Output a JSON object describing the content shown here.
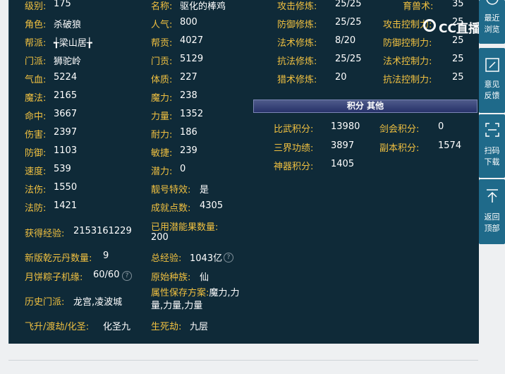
{
  "col1": {
    "level_label": "级别:",
    "level_value": "175",
    "role_label": "角色:",
    "role_value": "杀破狼",
    "gang_label": "帮派:",
    "gang_value": "╅梁山居╆",
    "sect_label": "门派:",
    "sect_value": "狮驼岭",
    "hp_label": "气血:",
    "hp_value": "5224",
    "mp_label": "魔法:",
    "mp_value": "2165",
    "hit_label": "命中:",
    "hit_value": "3667",
    "dmg_label": "伤害:",
    "dmg_value": "2397",
    "def_label": "防御:",
    "def_value": "1103",
    "spd_label": "速度:",
    "spd_value": "539",
    "mdmg_label": "法伤:",
    "mdmg_value": "1550",
    "mdef_label": "法防:",
    "mdef_value": "1421",
    "exp_label": "获得经验:",
    "exp_value": "2153161229",
    "qyd_label": "新版乾元丹数量:",
    "qyd_value": "9",
    "yb_label": "月饼粽子机缘:",
    "yb_value": "60/60",
    "hist_label": "历史门派:",
    "hist_value": "龙宫,凌波城",
    "fly_label": "飞升/渡劫/化圣:",
    "fly_value": "化圣九"
  },
  "col2": {
    "name_label": "名称:",
    "name_value": "驱化的棒鸡",
    "pop_label": "人气:",
    "pop_value": "800",
    "gc_label": "帮贡:",
    "gc_value": "4027",
    "mc_label": "门贡:",
    "mc_value": "5129",
    "con_label": "体质:",
    "con_value": "227",
    "mag_label": "魔力:",
    "mag_value": "238",
    "str_label": "力量:",
    "str_value": "1352",
    "end_label": "耐力:",
    "end_value": "186",
    "agi_label": "敏捷:",
    "agi_value": "239",
    "pot_label": "潜力:",
    "pot_value": "0",
    "pretty_label": "靓号特效:",
    "pretty_value": "是",
    "ach_label": "成就点数:",
    "ach_value": "4305",
    "used_label": "已用潜能果数量:",
    "used_value": "200",
    "total_label": "总经验:",
    "total_value": "1043亿",
    "race_label": "原始种族:",
    "race_value": "仙",
    "attr_label": "属性保存方案:",
    "attr_value": "魔力,力量,力量,力量",
    "sl_label": "生死劫:",
    "sl_value": "九层"
  },
  "col3": {
    "atk_label": "攻击修炼:",
    "atk_value": "25/25",
    "dfx_label": "防御修炼:",
    "dfx_value": "25/25",
    "mx_label": "法术修炼:",
    "mx_value": "8/20",
    "kx_label": "抗法修炼:",
    "kx_value": "25/25",
    "lx_label": "猎术修炼:",
    "lx_value": "20"
  },
  "col4": {
    "yg_label": "育兽术:",
    "yg_value": "35",
    "ac_label": "攻击控制力:",
    "ac_value": "25",
    "dc_label": "防御控制力:",
    "dc_value": "25",
    "mc_label": "法术控制力:",
    "mc_value": "25",
    "kc_label": "抗法控制力:",
    "kc_value": "25"
  },
  "section_title": "积分 其他",
  "scores": {
    "bw_label": "比武积分:",
    "bw_value": "13980",
    "jh_label": "剑会积分:",
    "jh_value": "0",
    "sj_label": "三界功绩:",
    "sj_value": "3897",
    "fb_label": "副本积分:",
    "fb_value": "1574",
    "sq_label": "神器积分:",
    "sq_value": "1405"
  },
  "sidebar": {
    "recent_1": "最近",
    "recent_2": "浏览",
    "feedback_1": "意见",
    "feedback_2": "反馈",
    "scan_1": "扫码",
    "scan_2": "下载",
    "top_1": "返回",
    "top_2": "顶部"
  },
  "help_glyph": "?",
  "watermark": "CC直播",
  "colors": {
    "panel_bg": "#0f2a38",
    "label": "#f0c040",
    "value": "#ffffff",
    "sidebar": "#1f6a8a"
  }
}
